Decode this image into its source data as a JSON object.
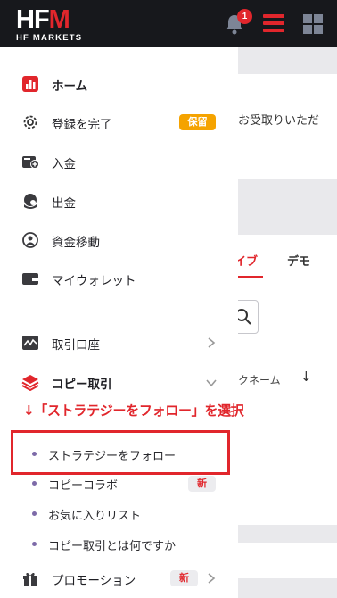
{
  "header": {
    "logo_text": "HFM",
    "logo_sub": "HF MARKETS",
    "notification_count": "1"
  },
  "background_page": {
    "partial_text": "お受取りいただ",
    "tab_live": "イブ",
    "tab_demo": "デモ",
    "column_nickname": "クネーム",
    "sort_icon": "↓"
  },
  "menu": {
    "home": "ホーム",
    "complete_registration": "登録を完了",
    "complete_registration_badge": "保留",
    "deposit": "入金",
    "withdrawal": "出金",
    "fund_transfer": "資金移動",
    "my_wallet": "マイウォレット",
    "trading_account": "取引口座",
    "copy_trading": "コピー取引",
    "copy_sub": {
      "follow_strategy": "ストラテジーをフォロー",
      "copy_collab": "コピーコラボ",
      "copy_collab_badge": "新",
      "favorites_list": "お気に入りリスト",
      "what_is_copy": "コピー取引とは何ですか"
    },
    "promotion": "プロモーション",
    "promotion_badge": "新"
  },
  "annotation": {
    "text": "↓「ストラテジーをフォロー」を選択"
  },
  "colors": {
    "brand_red": "#e1262c",
    "header_bg": "#17181c",
    "badge_orange": "#f5a300"
  }
}
